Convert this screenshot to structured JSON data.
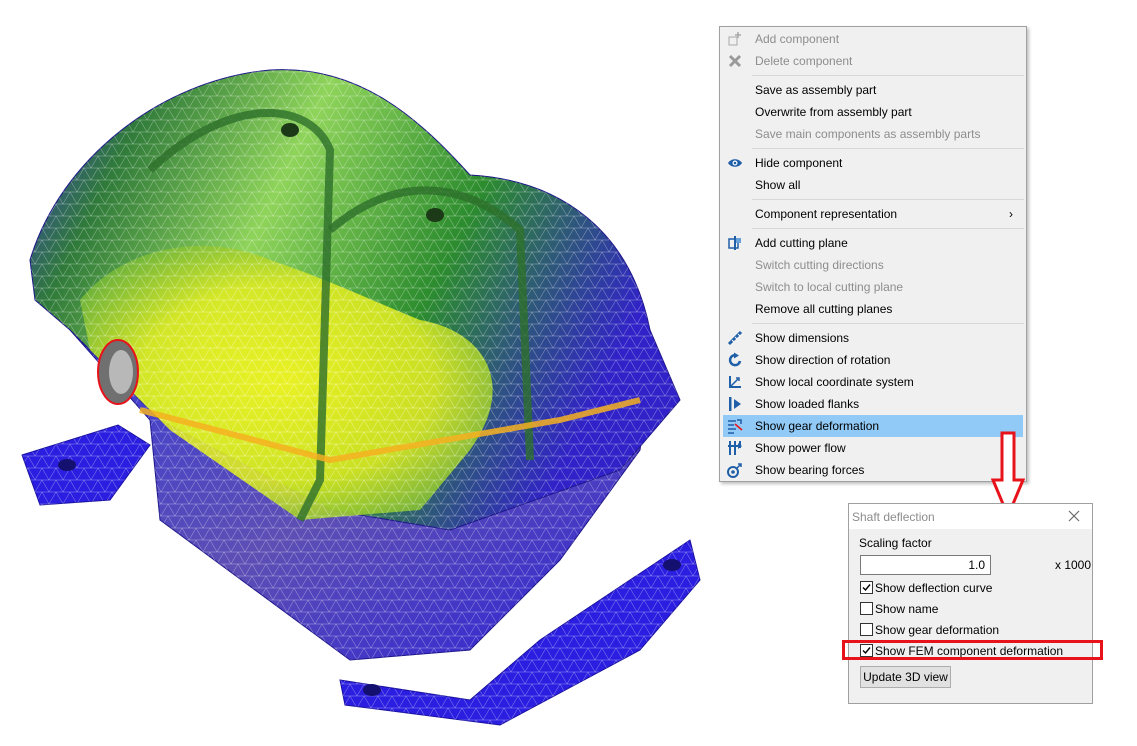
{
  "viewport": {
    "model": "gearbox-housing-fem-mesh",
    "colors": {
      "low": "#2a1fd8",
      "mid": "#2a9a2e",
      "high": "#f4f41a"
    }
  },
  "context_menu": {
    "groups": [
      [
        {
          "label": "Add component",
          "icon": "add-component-icon",
          "enabled": false
        },
        {
          "label": "Delete component",
          "icon": "delete-icon",
          "enabled": false
        }
      ],
      [
        {
          "label": "Save as assembly part",
          "icon": "",
          "enabled": true
        },
        {
          "label": "Overwrite from assembly part",
          "icon": "",
          "enabled": true
        },
        {
          "label": "Save main components as assembly parts",
          "icon": "",
          "enabled": false
        }
      ],
      [
        {
          "label": "Hide component",
          "icon": "eye-icon",
          "enabled": true
        },
        {
          "label": "Show all",
          "icon": "",
          "enabled": true
        }
      ],
      [
        {
          "label": "Component representation",
          "icon": "",
          "enabled": true,
          "submenu": true
        }
      ],
      [
        {
          "label": "Add cutting plane",
          "icon": "cutting-plane-icon",
          "enabled": true
        },
        {
          "label": "Switch cutting directions",
          "icon": "",
          "enabled": false
        },
        {
          "label": "Switch to local cutting plane",
          "icon": "",
          "enabled": false
        },
        {
          "label": "Remove all cutting planes",
          "icon": "",
          "enabled": true
        }
      ],
      [
        {
          "label": "Show dimensions",
          "icon": "ruler-icon",
          "enabled": true
        },
        {
          "label": "Show direction of rotation",
          "icon": "rotation-arrow-icon",
          "enabled": true
        },
        {
          "label": "Show local coordinate system",
          "icon": "coordinate-system-icon",
          "enabled": true
        },
        {
          "label": "Show loaded flanks",
          "icon": "loaded-flanks-icon",
          "enabled": true
        },
        {
          "label": "Show gear deformation",
          "icon": "gear-deformation-icon",
          "enabled": true,
          "highlighted": true
        },
        {
          "label": "Show power flow",
          "icon": "power-flow-icon",
          "enabled": true
        },
        {
          "label": "Show bearing forces",
          "icon": "bearing-forces-icon",
          "enabled": true
        }
      ]
    ],
    "submenu_arrow": "›",
    "highlight_color": "#91c9f7"
  },
  "annotation": {
    "arrow_color": "#e8131a",
    "highlight_color": "#e8131a"
  },
  "dialog": {
    "title": "Shaft deflection",
    "close_icon": "close-icon",
    "scaling_label": "Scaling factor",
    "scaling_value": "1.0",
    "scaling_unit": "x 1000",
    "checkboxes": [
      {
        "label": "Show deflection curve",
        "checked": true
      },
      {
        "label": "Show name",
        "checked": false
      },
      {
        "label": "Show gear deformation",
        "checked": false
      },
      {
        "label": "Show FEM component deformation",
        "checked": true,
        "highlighted": true
      }
    ],
    "update_button": "Update 3D view"
  }
}
